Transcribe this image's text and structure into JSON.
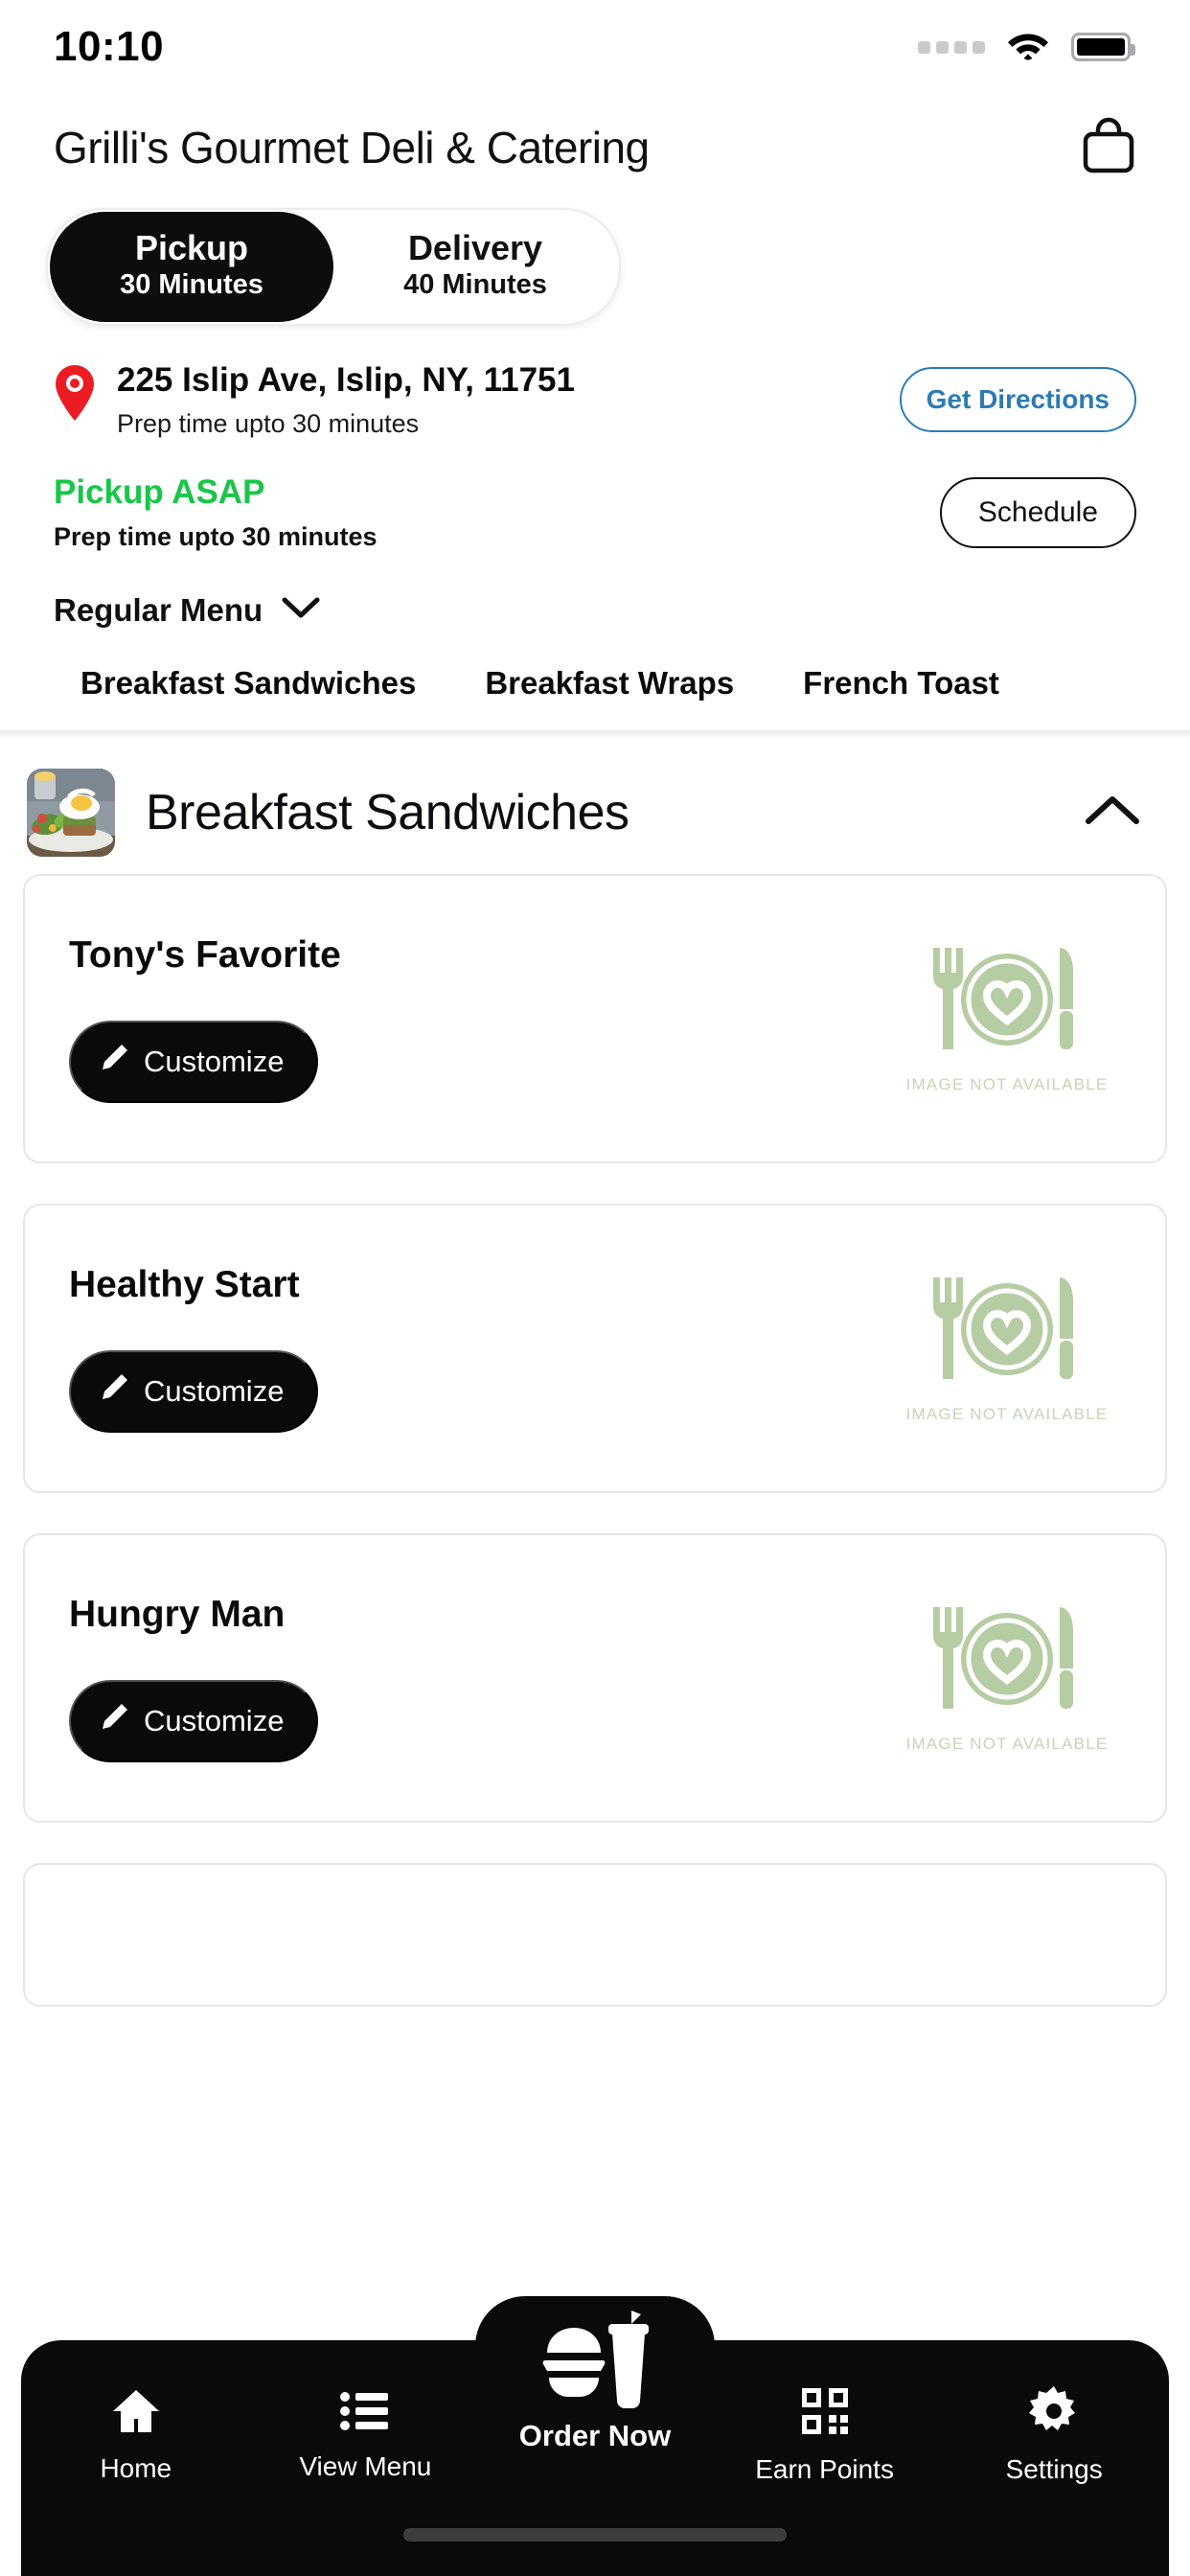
{
  "status_bar": {
    "time": "10:10",
    "signal_icon": "signal-dots-icon",
    "wifi_icon": "wifi-icon",
    "battery_icon": "battery-full-icon"
  },
  "header": {
    "store_name": "Grilli's Gourmet Deli & Catering",
    "cart_icon": "shopping-bag-icon"
  },
  "order_mode": {
    "selected": "Pickup",
    "options": [
      {
        "label": "Pickup",
        "time": "30 Minutes",
        "active": true
      },
      {
        "label": "Delivery",
        "time": "40 Minutes",
        "active": false
      }
    ]
  },
  "location": {
    "pin_icon": "map-pin-icon",
    "address": "225 Islip Ave, Islip, NY, 11751",
    "prep_time": "Prep time upto 30 minutes",
    "directions_button": "Get Directions",
    "directions_color": "#2C7BB6"
  },
  "timing": {
    "label": "Pickup ASAP",
    "label_color": "#19C64A",
    "prep_time": "Prep time upto 30 minutes",
    "schedule_button": "Schedule"
  },
  "menu_selector": {
    "label": "Regular Menu",
    "chevron_icon": "chevron-down-icon"
  },
  "category_tabs": [
    {
      "label": "Breakfast Sandwiches",
      "active": true
    },
    {
      "label": "Breakfast Wraps",
      "active": false
    },
    {
      "label": "French Toast",
      "active": false
    }
  ],
  "section": {
    "title": "Breakfast Sandwiches",
    "thumbnail_icon": "breakfast-plate-photo",
    "collapse_icon": "chevron-up-icon",
    "expanded": true
  },
  "items": [
    {
      "name": "Tony's Favorite",
      "customize_label": "Customize",
      "customize_icon": "pencil-icon",
      "image_placeholder_text": "IMAGE NOT AVAILABLE",
      "image_placeholder_icon": "plate-fork-knife-heart-icon"
    },
    {
      "name": "Healthy Start",
      "customize_label": "Customize",
      "customize_icon": "pencil-icon",
      "image_placeholder_text": "IMAGE NOT AVAILABLE",
      "image_placeholder_icon": "plate-fork-knife-heart-icon"
    },
    {
      "name": "Hungry Man",
      "customize_label": "Customize",
      "customize_icon": "pencil-icon",
      "image_placeholder_text": "IMAGE NOT AVAILABLE",
      "image_placeholder_icon": "plate-fork-knife-heart-icon"
    }
  ],
  "bottom_nav": {
    "items": [
      {
        "label": "Home",
        "icon": "home-icon",
        "active": false
      },
      {
        "label": "View Menu",
        "icon": "list-icon",
        "active": false
      },
      {
        "label": "Order Now",
        "icon": "burger-drink-icon",
        "active": true
      },
      {
        "label": "Earn Points",
        "icon": "qr-code-icon",
        "active": false
      },
      {
        "label": "Settings",
        "icon": "gear-icon",
        "active": false
      }
    ]
  },
  "theme": {
    "accent_dark": "#0A0A0A",
    "link_blue": "#2C7BB6",
    "success_green": "#19C64A",
    "placeholder_green": "#B6CCA3"
  }
}
